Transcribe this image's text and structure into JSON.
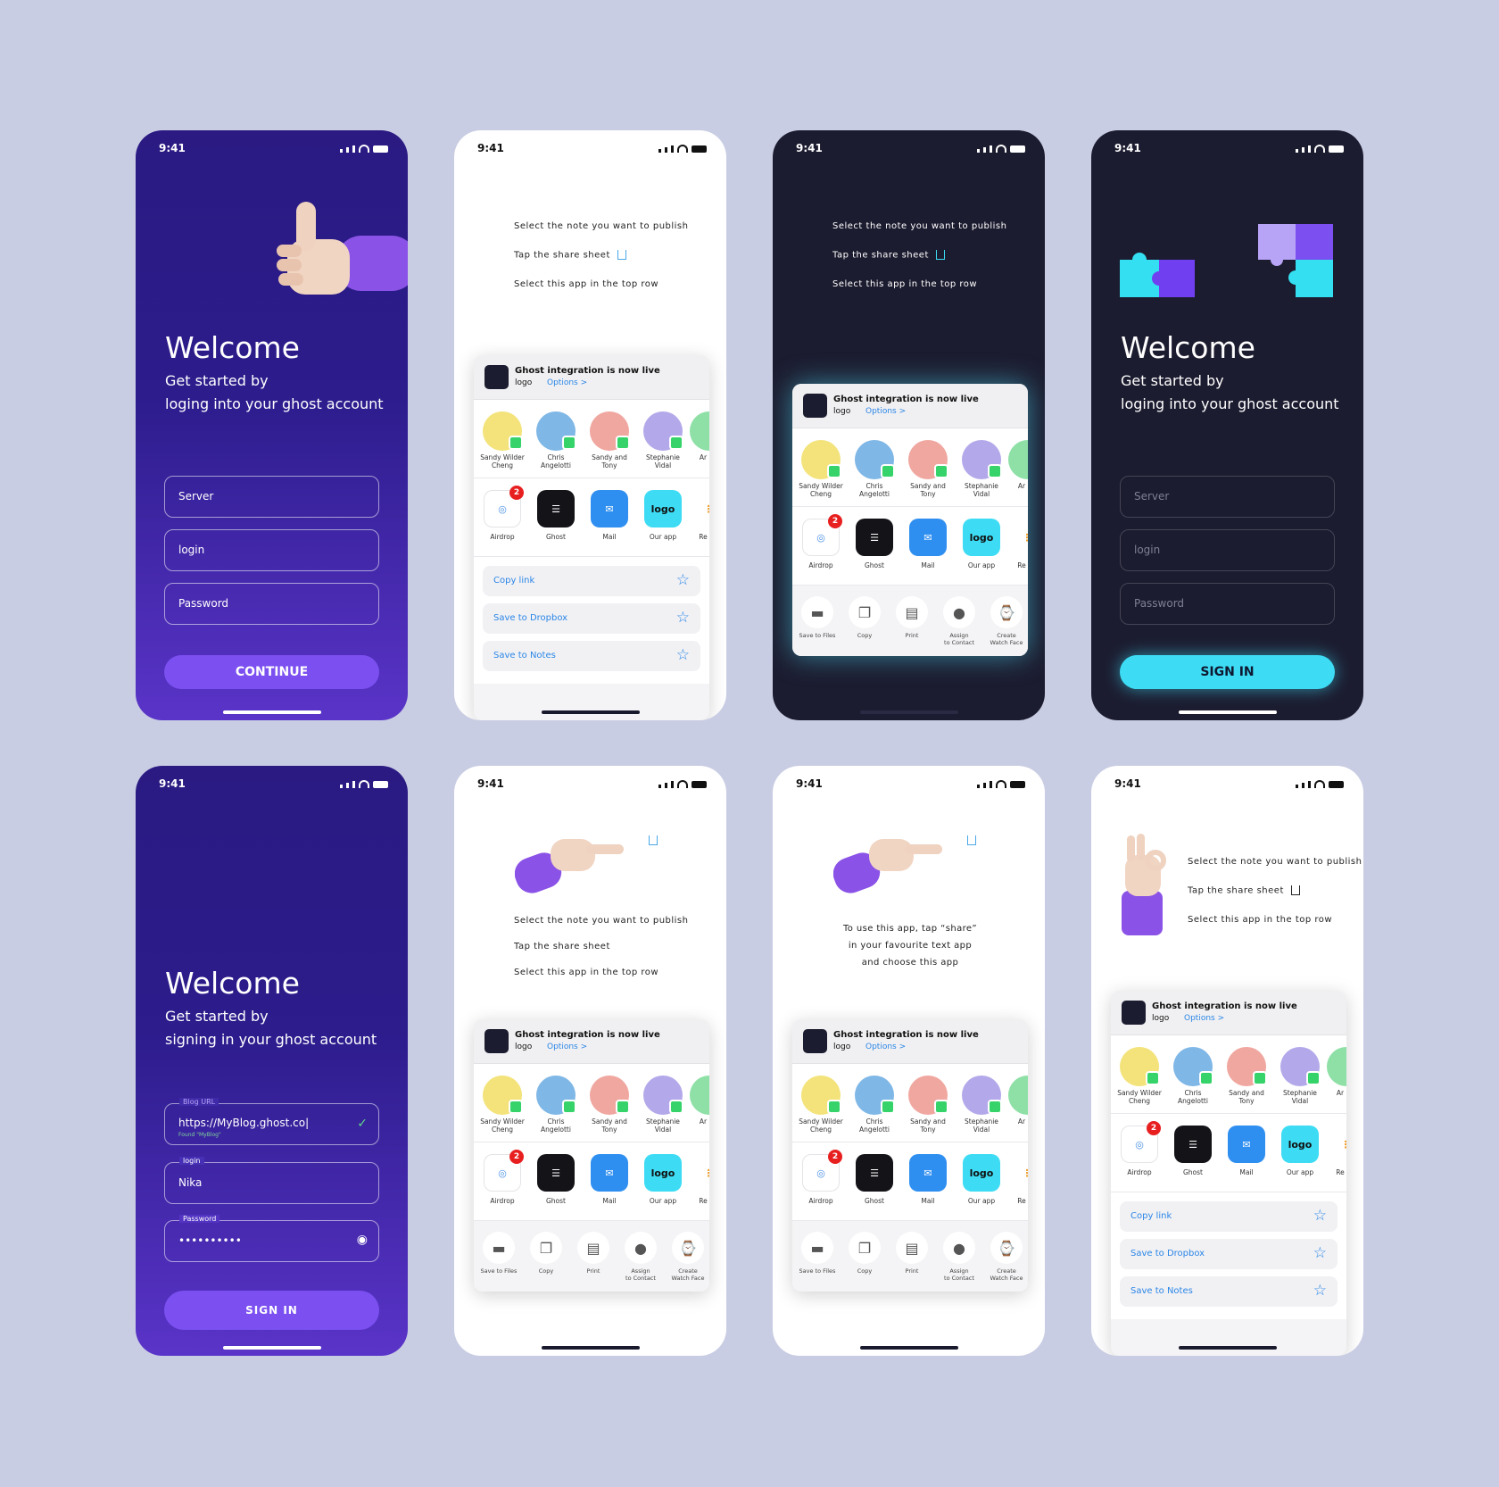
{
  "status_time": "9:41",
  "welcome": {
    "title": "Welcome",
    "subtitle_line1": "Get started by",
    "subtitle_line2": "loging into your ghost account",
    "subtitle_alt_line2": "signing in your ghost account",
    "server_placeholder": "Server",
    "login_placeholder": "login",
    "password_placeholder": "Password",
    "continue_label": "CONTINUE",
    "signin_label": "SIGN IN",
    "signin_label_spaced": "SIGN IN"
  },
  "filled_form": {
    "blog_url_label": "Blog URL",
    "blog_url_value": "https://MyBlog.ghost.co|",
    "blog_found": "Found \"MyBlog\"",
    "login_label": "login",
    "login_value": "Nika",
    "password_label": "Password",
    "password_value": "••••••••••"
  },
  "instructions": {
    "step1": "Select the note you want to publish",
    "step2": "Tap the share sheet",
    "step3": "Select this app in the top row",
    "hint_line1": "To use this app, tap “share”",
    "hint_line2": "in your favourite text app",
    "hint_line3": "and choose this app"
  },
  "share_sheet": {
    "title": "Ghost integration is now live",
    "subtitle": "logo",
    "options": "Options >",
    "people": [
      {
        "line1": "Sandy Wilder",
        "line2": "Cheng",
        "color": "#f3e37a"
      },
      {
        "line1": "Chris",
        "line2": "Angelotti",
        "color": "#7fb7e6"
      },
      {
        "line1": "Sandy and",
        "line2": "Tony",
        "color": "#f0a7a0"
      },
      {
        "line1": "Stephanie",
        "line2": "Vidal",
        "color": "#b3a9ea"
      },
      {
        "line1": "Ar",
        "line2": "",
        "color": "#8ee0a6"
      }
    ],
    "apps": [
      {
        "name": "Airdrop",
        "badge": "2"
      },
      {
        "name": "Ghost"
      },
      {
        "name": "Mail"
      },
      {
        "name": "Our app",
        "glyph": "logo"
      },
      {
        "name": "Re"
      }
    ],
    "actions": [
      "Copy link",
      "Save to Dropbox",
      "Save to Notes"
    ],
    "tools": [
      {
        "line1": "Save to Files",
        "line2": ""
      },
      {
        "line1": "Copy",
        "line2": ""
      },
      {
        "line1": "Print",
        "line2": ""
      },
      {
        "line1": "Assign",
        "line2": "to Contact"
      },
      {
        "line1": "Create",
        "line2": "Watch Face"
      }
    ]
  },
  "colors": {
    "background": "#c9cde3",
    "purple_accent": "#7b4ff0",
    "cyan_accent": "#3ddcf4",
    "dark_bg": "#1c1c30",
    "link_blue": "#2b86e6"
  }
}
